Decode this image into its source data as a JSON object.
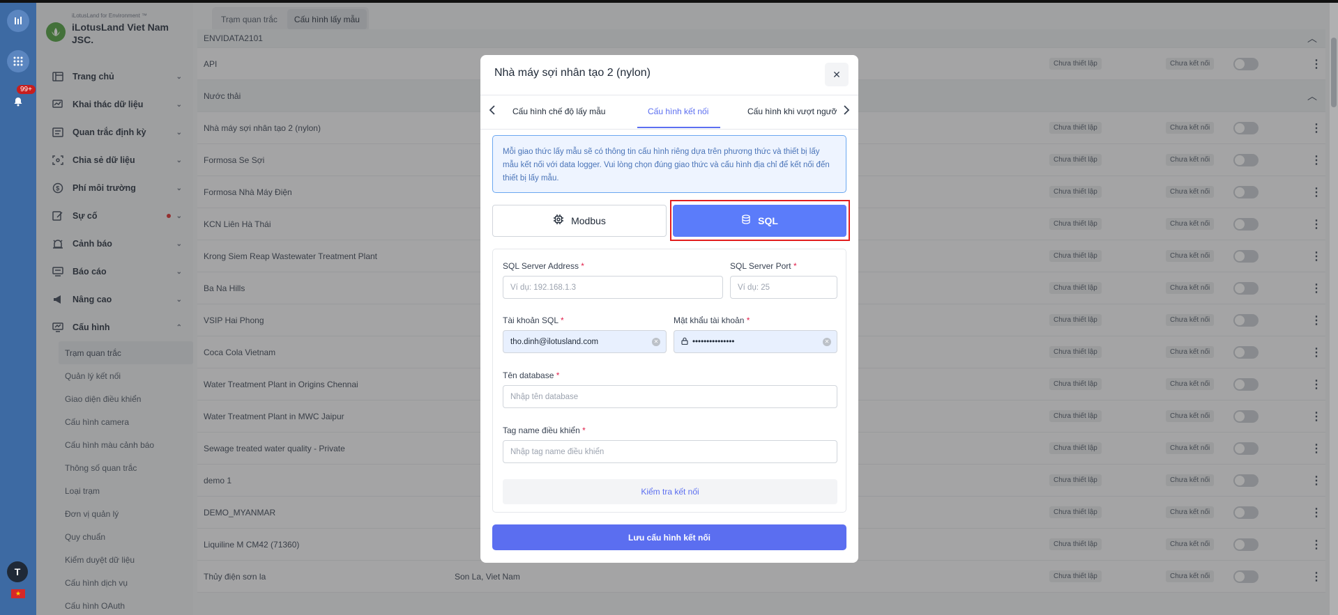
{
  "rail": {
    "notification_badge": "99+",
    "avatar_initial": "T",
    "flag_glyph": "★"
  },
  "brand": {
    "subtitle": "iLotusLand for Environment ™",
    "name": "iLotusLand Viet Nam JSC."
  },
  "sidebar": {
    "items": [
      {
        "label": "Trang chủ",
        "icon": "layout-icon"
      },
      {
        "label": "Khai thác dữ liệu",
        "icon": "chart-edit-icon"
      },
      {
        "label": "Quan trắc định kỳ",
        "icon": "list-box-icon"
      },
      {
        "label": "Chia sẻ dữ liệu",
        "icon": "share-frame-icon"
      },
      {
        "label": "Phí môi trường",
        "icon": "dollar-circle-icon"
      },
      {
        "label": "Sự cố",
        "icon": "edit-note-icon"
      },
      {
        "label": "Cảnh báo",
        "icon": "alarm-icon"
      },
      {
        "label": "Báo cáo",
        "icon": "report-icon"
      },
      {
        "label": "Nâng cao",
        "icon": "megaphone-icon"
      },
      {
        "label": "Cấu hình",
        "icon": "monitor-icon"
      }
    ],
    "subitems": [
      "Trạm quan trắc",
      "Quản lý kết nối",
      "Giao diện điều khiển",
      "Cấu hình camera",
      "Cấu hình màu cảnh báo",
      "Thông số quan trắc",
      "Loại trạm",
      "Đơn vị quản lý",
      "Quy chuẩn",
      "Kiểm duyệt dữ liệu",
      "Cấu hình dịch vụ",
      "Cấu hình OAuth"
    ]
  },
  "main_tabs": [
    "Trạm quan trắc",
    "Cấu hình lấy mẫu"
  ],
  "table": {
    "status_not_set": "Chưa thiết lập",
    "status_not_connected": "Chưa kết nối",
    "rows": [
      {
        "name": "ENVIDATA2101",
        "group": true,
        "loc": ""
      },
      {
        "name": "API",
        "group": false,
        "loc": ""
      },
      {
        "name": "Nước thải",
        "group": true,
        "loc": ""
      },
      {
        "name": "Nhà máy sợi nhân tạo 2 (nylon)",
        "group": false,
        "loc": ""
      },
      {
        "name": "Formosa Se Sợi",
        "group": false,
        "loc": ""
      },
      {
        "name": "Formosa Nhà Máy Điện",
        "group": false,
        "loc": ""
      },
      {
        "name": "KCN Liên Hà Thái",
        "group": false,
        "loc": ""
      },
      {
        "name": "Krong Siem Reap Wastewater Treatment Plant",
        "group": false,
        "loc": ""
      },
      {
        "name": "Ba Na Hills",
        "group": false,
        "loc": ""
      },
      {
        "name": "VSIP Hai Phong",
        "group": false,
        "loc": ""
      },
      {
        "name": "Coca Cola Vietnam",
        "group": false,
        "loc": ""
      },
      {
        "name": "Water Treatment Plant in Origins Chennai",
        "group": false,
        "loc": ""
      },
      {
        "name": "Water Treatment Plant in MWC Jaipur",
        "group": false,
        "loc": ""
      },
      {
        "name": "Sewage treated water quality - Private",
        "group": false,
        "loc": ""
      },
      {
        "name": "demo 1",
        "group": false,
        "loc": ""
      },
      {
        "name": "DEMO_MYANMAR",
        "group": false,
        "loc": ""
      },
      {
        "name": "Liquiline M CM42 (71360)",
        "group": false,
        "loc": ""
      },
      {
        "name": "Thủy điện sơn la",
        "group": false,
        "loc": "Son La, Viet Nam"
      }
    ]
  },
  "modal": {
    "title": "Nhà máy sợi nhân tạo 2 (nylon)",
    "close_glyph": "✕",
    "tabs": [
      "Cấu hình chế độ lấy mẫu",
      "Cấu hình kết nối",
      "Cấu hình khi vượt ngưỡ"
    ],
    "active_tab_index": 1,
    "info_text": "Mỗi giao thức lấy mẫu sẽ có thông tin cấu hình riêng dựa trên phương thức và thiết bị lấy mẫu kết nối với data logger. Vui lòng chọn đúng giao thức và cấu hình địa chỉ để kết nối đến thiết bị lấy mẫu.",
    "protocols": {
      "modbus": "Modbus",
      "sql": "SQL",
      "selected": "SQL"
    },
    "fields": {
      "server_address": {
        "label": "SQL Server Address",
        "placeholder": "Ví dụ: 192.168.1.3",
        "value": ""
      },
      "server_port": {
        "label": "SQL Server Port",
        "placeholder": "Ví dụ: 25",
        "value": ""
      },
      "account": {
        "label": "Tài khoản SQL",
        "value": "tho.dinh@ilotusland.com"
      },
      "password": {
        "label": "Mật khẩu tài khoản",
        "value": "•••••••••••••••"
      },
      "database": {
        "label": "Tên database",
        "placeholder": "Nhập tên database",
        "value": ""
      },
      "tag_name": {
        "label": "Tag name điều khiển",
        "placeholder": "Nhập tag name điều khiển",
        "value": ""
      }
    },
    "required_mark": "*",
    "test_button": "Kiểm tra kết nối",
    "save_button": "Lưu cấu hình kết nối"
  },
  "colors": {
    "accent": "#5b6ef0",
    "sql_button": "#5b7cfa",
    "highlight": "#e21d1d",
    "rail": "#3d6aa3"
  }
}
